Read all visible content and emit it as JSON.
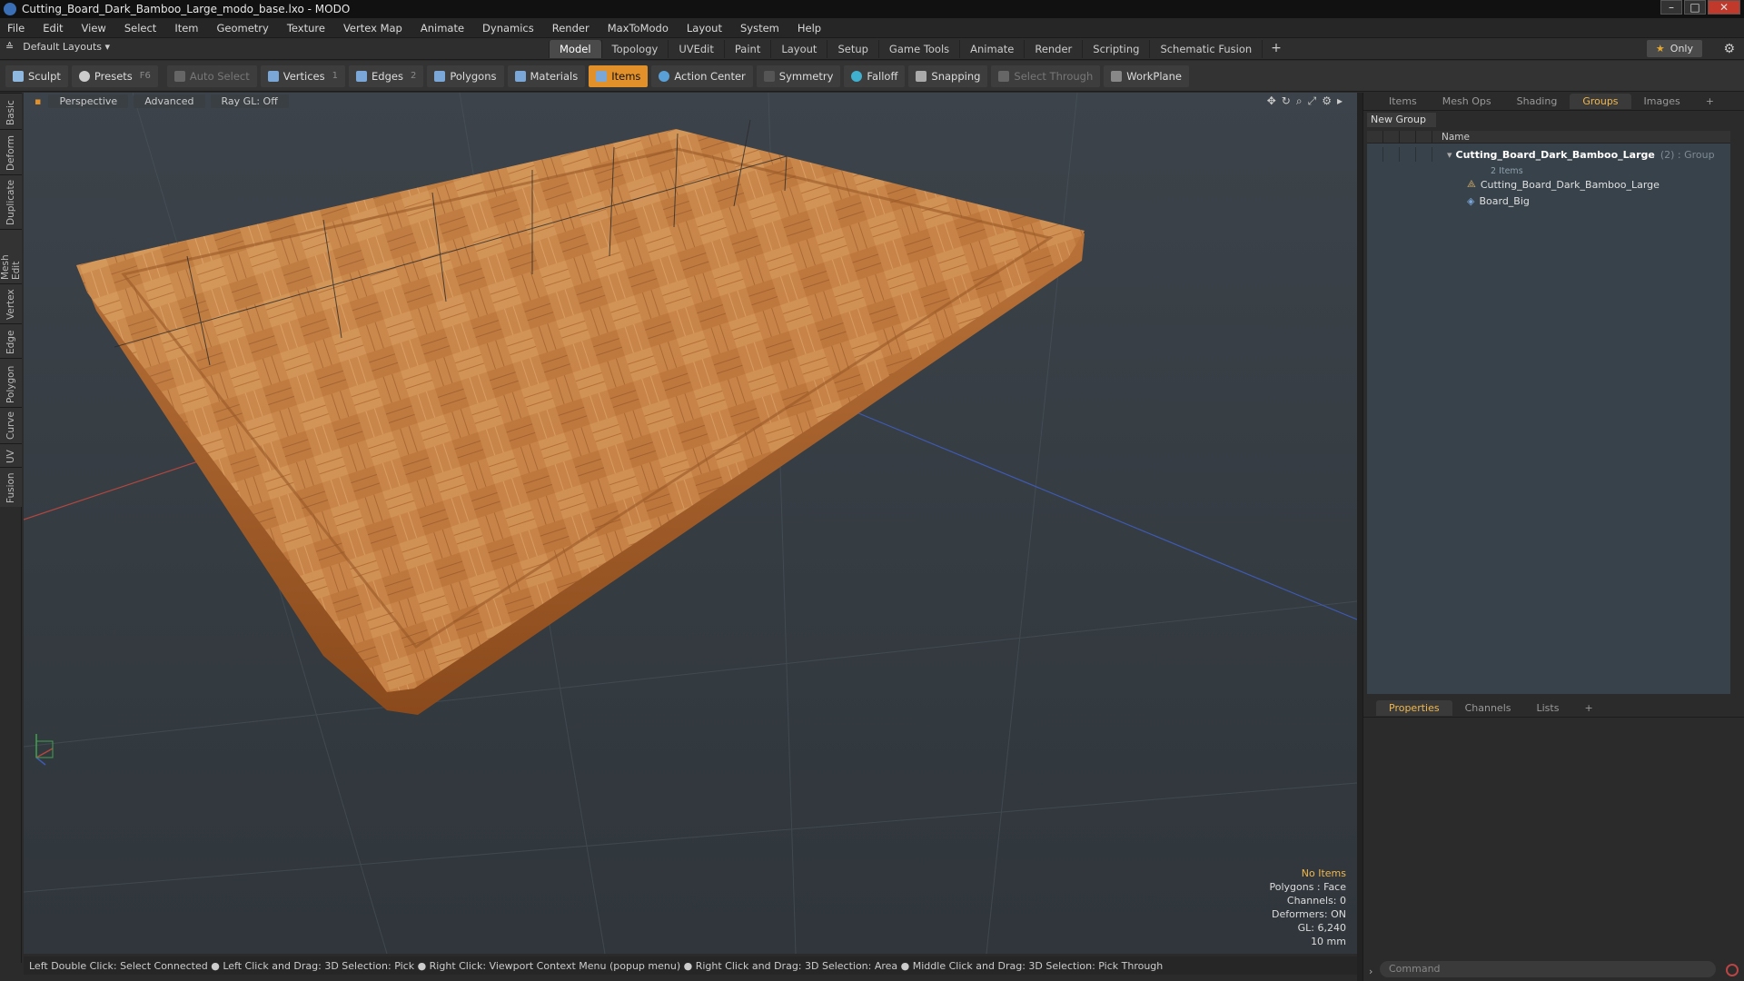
{
  "window": {
    "title": "Cutting_Board_Dark_Bamboo_Large_modo_base.lxo - MODO"
  },
  "menu": [
    "File",
    "Edit",
    "View",
    "Select",
    "Item",
    "Geometry",
    "Texture",
    "Vertex Map",
    "Animate",
    "Dynamics",
    "Render",
    "MaxToModo",
    "Layout",
    "System",
    "Help"
  ],
  "layout": {
    "preset": "Default Layouts ▾",
    "only_label": "Only"
  },
  "tabs": [
    "Model",
    "Topology",
    "UVEdit",
    "Paint",
    "Layout",
    "Setup",
    "Game Tools",
    "Animate",
    "Render",
    "Scripting",
    "Schematic Fusion"
  ],
  "toolbar": {
    "sculpt": "Sculpt",
    "presets": "Presets",
    "presets_key": "F6",
    "autoselect": "Auto Select",
    "vertices": "Vertices",
    "vertices_count": "1",
    "edges": "Edges",
    "edges_count": "2",
    "polygons": "Polygons",
    "materials": "Materials",
    "items": "Items",
    "action_center": "Action Center",
    "symmetry": "Symmetry",
    "falloff": "Falloff",
    "snapping": "Snapping",
    "select_through": "Select Through",
    "workplane": "WorkPlane"
  },
  "left_tabs": [
    "Basic",
    "Deform",
    "Duplicate",
    "Mesh Edit",
    "Vertex",
    "Edge",
    "Polygon",
    "Curve",
    "UV",
    "Fusion"
  ],
  "viewport": {
    "view": "Perspective",
    "mode": "Advanced",
    "raygl": "Ray GL: Off",
    "hud": {
      "items": "No Items",
      "polygons": "Polygons : Face",
      "channels": "Channels: 0",
      "deformers": "Deformers: ON",
      "gl": "GL: 6,240",
      "scale": "10 mm"
    }
  },
  "status": "Left Double Click: Select Connected ● Left Click and Drag: 3D Selection: Pick ● Right Click: Viewport Context Menu (popup menu) ● Right Click and Drag: 3D Selection: Area ● Middle Click and Drag: 3D Selection: Pick Through",
  "panel": {
    "tabs": [
      "Items",
      "Mesh Ops",
      "Shading",
      "Groups",
      "Images"
    ],
    "new_group": "New Group",
    "column_name": "Name",
    "group_name": "Cutting_Board_Dark_Bamboo_Large",
    "group_suffix": "(2) : Group",
    "group_count": "2 Items",
    "children": [
      "Cutting_Board_Dark_Bamboo_Large",
      "Board_Big"
    ],
    "bottom_tabs": [
      "Properties",
      "Channels",
      "Lists"
    ],
    "command_placeholder": "Command"
  },
  "colors": {
    "accent": "#e2912a",
    "wood_light": "#d79a5a",
    "wood_dark": "#8a4a1e"
  }
}
